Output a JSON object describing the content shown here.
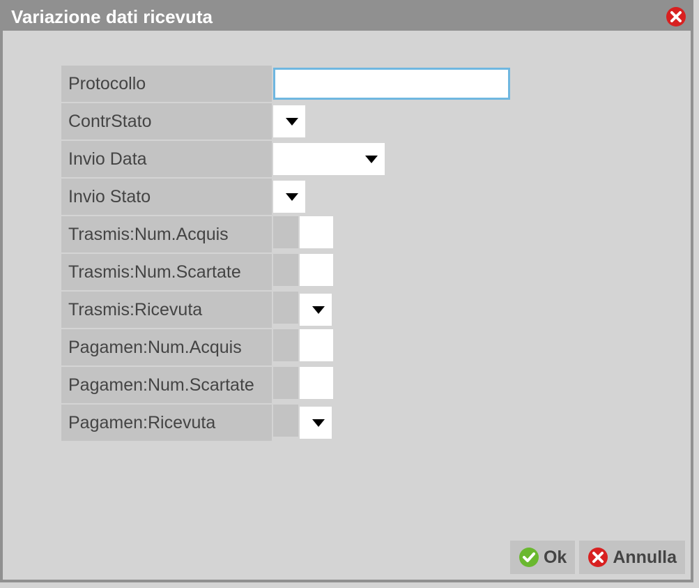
{
  "dialog": {
    "title": "Variazione dati ricevuta"
  },
  "fields": {
    "protocollo": {
      "label": "Protocollo",
      "value": ""
    },
    "contrStato": {
      "label": "ContrStato"
    },
    "invioData": {
      "label": "Invio Data"
    },
    "invioStato": {
      "label": "Invio Stato"
    },
    "trasmisNumAcquis": {
      "label": "Trasmis:Num.Acquis",
      "value": ""
    },
    "trasmisNumScartate": {
      "label": "Trasmis:Num.Scartate",
      "value": ""
    },
    "trasmisRicevuta": {
      "label": "Trasmis:Ricevuta"
    },
    "pagamenNumAcquis": {
      "label": "Pagamen:Num.Acquis",
      "value": ""
    },
    "pagamenNumScartate": {
      "label": "Pagamen:Num.Scartate",
      "value": ""
    },
    "pagamenRicevuta": {
      "label": "Pagamen:Ricevuta"
    }
  },
  "buttons": {
    "ok": "Ok",
    "cancel": "Annulla"
  }
}
